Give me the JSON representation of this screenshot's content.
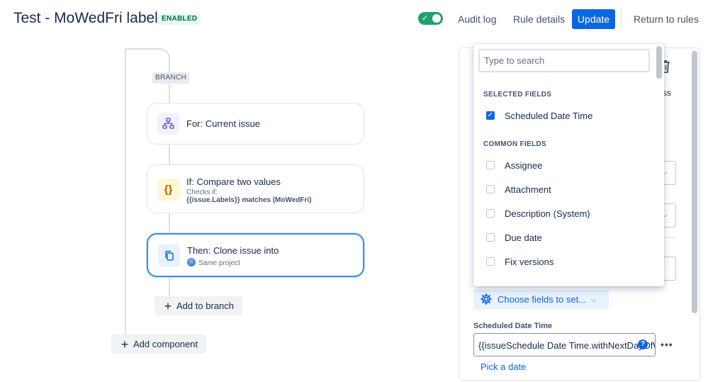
{
  "header": {
    "title": "Test - MoWedFri label",
    "status_badge": "ENABLED",
    "toggle_check": "✓",
    "audit_log": "Audit log",
    "rule_details": "Rule details",
    "update": "Update",
    "return_to_rules": "Return to rules"
  },
  "flow": {
    "branch_tag": "BRANCH",
    "cards": [
      {
        "icon": "hierarchy-icon",
        "title": "For: Current issue"
      },
      {
        "icon": "curly-braces-icon",
        "glyph": "{}",
        "title": "If: Compare two values",
        "sub": "Checks if:",
        "sub2": "{{issue.Labels}} matches (MoWedFri)"
      },
      {
        "icon": "copy-icon",
        "title": "Then: Clone issue into",
        "sub": "Same project"
      }
    ],
    "add_to_branch": "Add to branch",
    "add_component": "Add component"
  },
  "panel": {
    "peek_text": "ss",
    "choose_fields": "Choose fields to set...",
    "field_label": "Scheduled Date Time",
    "field_value": "{{issueSchedule Date Time.withNextDayOfW",
    "help_glyph": "?",
    "more_glyph": "•••",
    "pick_date": "Pick a date"
  },
  "dropdown": {
    "search_placeholder": "Type to search",
    "selected_header": "SELECTED FIELDS",
    "selected": [
      {
        "label": "Scheduled Date Time",
        "checked": true
      }
    ],
    "common_header": "COMMON FIELDS",
    "common": [
      {
        "label": "Assignee",
        "checked": false
      },
      {
        "label": "Attachment",
        "checked": false
      },
      {
        "label": "Description (System)",
        "checked": false
      },
      {
        "label": "Due date",
        "checked": false
      },
      {
        "label": "Fix versions",
        "checked": false
      }
    ]
  },
  "colors": {
    "accent": "#0c66e4",
    "toggle_on": "#22a06b",
    "selected_border": "#388bff"
  }
}
